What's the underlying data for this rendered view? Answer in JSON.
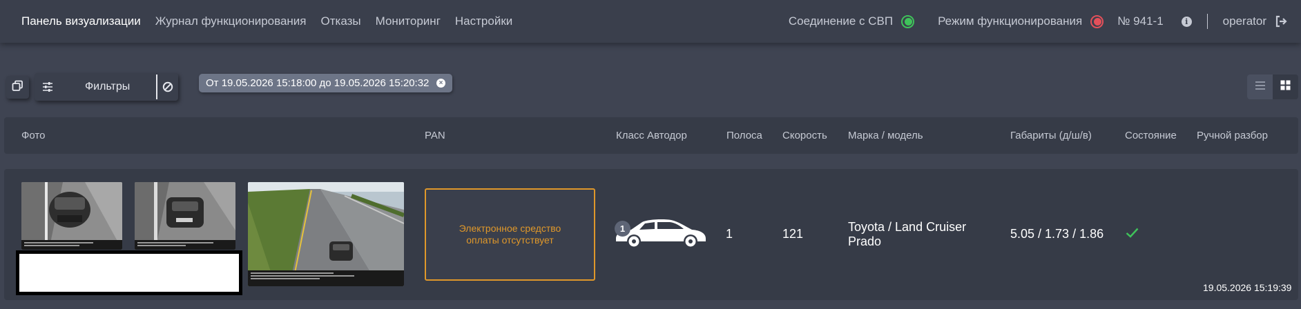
{
  "nav": {
    "items": [
      {
        "label": "Панель визуализации",
        "active": true
      },
      {
        "label": "Журнал функционирования",
        "active": false
      },
      {
        "label": "Отказы",
        "active": false
      },
      {
        "label": "Мониторинг",
        "active": false
      },
      {
        "label": "Настройки",
        "active": false
      }
    ],
    "connection_label": "Соединение с СВП",
    "connection_status_color": "#3fc25a",
    "mode_label": "Режим функционирования",
    "mode_status_color": "#e4505a",
    "device_number": "№ 941-1",
    "info_icon": "info-icon",
    "username": "operator",
    "logout_icon": "logout-icon"
  },
  "toolbar": {
    "copy_icon": "copy-icon",
    "filters_label": "Фильтры",
    "sliders_icon": "sliders-icon",
    "clear_icon": "block-icon",
    "filter_chip": "От 19.05.2026 15:18:00 до 19.05.2026 15:20:32",
    "chip_close_icon": "close-circle-icon",
    "view_list_icon": "list-icon",
    "view_grid_icon": "grid-icon",
    "active_view": "grid"
  },
  "table": {
    "columns": [
      "Фото",
      "PAN",
      "Класс Автодор",
      "Полоса",
      "Скорость",
      "Марка / модель",
      "Габариты (д/ш/в)",
      "Состояние",
      "Ручной разбор"
    ],
    "rows": [
      {
        "pan_message": "Электронное средство оплаты отсутствует",
        "class_number": "1",
        "class_icon": "car-icon",
        "lane": "1",
        "speed": "121",
        "make_model": "Toyota / Land Cruiser Prado",
        "dimensions": "5.05 / 1.73 / 1.86",
        "state_icon": "check-icon",
        "state_color": "#3fc25a",
        "timestamp": "19.05.2026 15:19:39"
      }
    ]
  },
  "colors": {
    "background": "#3f4452",
    "panel": "#363b47",
    "accent_orange": "#e0982a",
    "chip": "#6d7587"
  }
}
